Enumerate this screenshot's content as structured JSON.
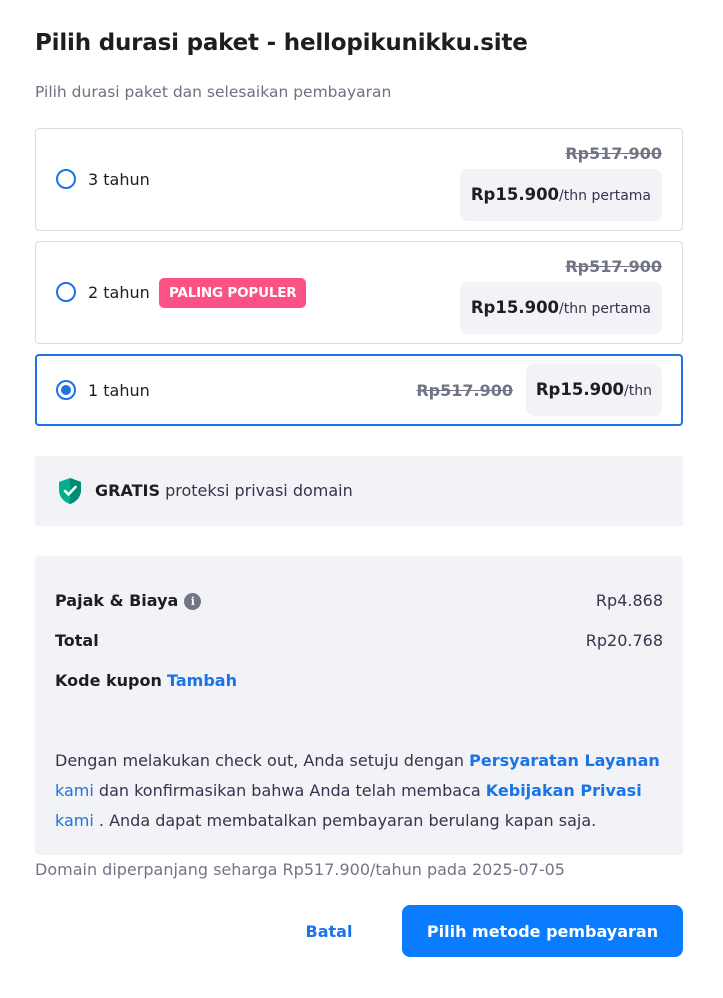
{
  "header": {
    "title": "Pilih durasi paket - hellopikunikku.site",
    "subtitle": "Pilih durasi paket dan selesaikan pembayaran"
  },
  "plans": [
    {
      "label": "3 tahun",
      "old_price": "Rp517.900",
      "price": "Rp15.900",
      "unit": "/thn pertama",
      "selected": false
    },
    {
      "label": "2 tahun",
      "badge": "PALING POPULER",
      "old_price": "Rp517.900",
      "price": "Rp15.900",
      "unit": "/thn pertama",
      "selected": false
    },
    {
      "label": "1 tahun",
      "old_price": "Rp517.900",
      "price": "Rp15.900",
      "unit": "/thn",
      "selected": true
    }
  ],
  "privacy": {
    "bold": "GRATIS",
    "text": " proteksi privasi domain",
    "icon": "shield-check-icon",
    "icon_color": "#00b090"
  },
  "summary": {
    "tax_label": "Pajak & Biaya",
    "tax_info_icon": "i",
    "tax_value": "Rp4.868",
    "total_label": "Total",
    "total_value": "Rp20.768",
    "coupon_label": "Kode kupon",
    "coupon_link": "Tambah",
    "terms": {
      "part1": "Dengan melakukan check out, Anda setuju dengan ",
      "link1_bold": "Persyaratan Layanan",
      "link1_plain": "kami",
      "part2": " dan konfirmasikan bahwa Anda telah membaca ",
      "link2_bold": "Kebijakan Privasi",
      "link2_plain": "kami",
      "part3": " . Anda dapat membatalkan pembayaran berulang kapan saja."
    }
  },
  "renewal_note": "Domain diperpanjang seharga Rp517.900/tahun pada 2025-07-05",
  "actions": {
    "cancel": "Batal",
    "primary": "Pilih metode pembayaran"
  },
  "colors": {
    "accent": "#1a73e8",
    "primary_button": "#0a7cff",
    "badge": "#fc5185",
    "panel": "#f2f3f6"
  }
}
